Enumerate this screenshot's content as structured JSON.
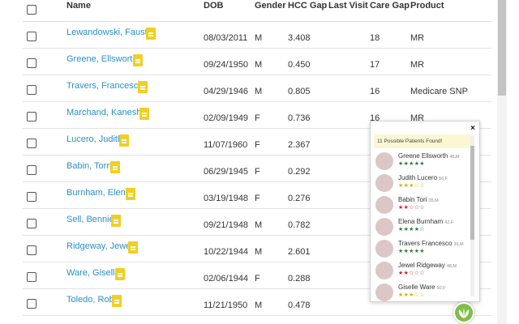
{
  "table": {
    "headers": {
      "name": "Name",
      "dob": "DOB",
      "gender": "Gender",
      "hcc_gap": "HCC Gap",
      "last_visit": "Last Visit",
      "care_gap": "Care Gap",
      "product": "Product"
    },
    "rows": [
      {
        "name": "Lewandowski, Fausto",
        "dob": "08/03/2011",
        "gender": "M",
        "hcc_gap": "3.408",
        "last_visit": "",
        "care_gap": "18",
        "product": "MR"
      },
      {
        "name": "Greene, Ellsworth",
        "dob": "09/24/1950",
        "gender": "M",
        "hcc_gap": "0.450",
        "last_visit": "",
        "care_gap": "17",
        "product": "MR"
      },
      {
        "name": "Travers, Francesco",
        "dob": "04/29/1946",
        "gender": "M",
        "hcc_gap": "0.805",
        "last_visit": "",
        "care_gap": "16",
        "product": "Medicare SNP"
      },
      {
        "name": "Marchand, Kanesha",
        "dob": "02/09/1949",
        "gender": "F",
        "hcc_gap": "0.736",
        "last_visit": "",
        "care_gap": "16",
        "product": "MR"
      },
      {
        "name": "Lucero, Judith",
        "dob": "11/07/1960",
        "gender": "F",
        "hcc_gap": "2.367",
        "last_visit": "",
        "care_gap": "",
        "product": ""
      },
      {
        "name": "Babin, Torri",
        "dob": "06/29/1945",
        "gender": "F",
        "hcc_gap": "0.292",
        "last_visit": "",
        "care_gap": "",
        "product": ""
      },
      {
        "name": "Burnham, Elena",
        "dob": "03/19/1948",
        "gender": "F",
        "hcc_gap": "0.276",
        "last_visit": "",
        "care_gap": "",
        "product": ""
      },
      {
        "name": "Sell, Bennie",
        "dob": "09/21/1948",
        "gender": "M",
        "hcc_gap": "0.782",
        "last_visit": "",
        "care_gap": "",
        "product": ""
      },
      {
        "name": "Ridgeway, Jewel",
        "dob": "10/22/1944",
        "gender": "M",
        "hcc_gap": "2.601",
        "last_visit": "",
        "care_gap": "",
        "product": ""
      },
      {
        "name": "Ware, Giselle",
        "dob": "02/06/1944",
        "gender": "F",
        "hcc_gap": "0.288",
        "last_visit": "",
        "care_gap": "",
        "product": ""
      },
      {
        "name": "Toledo, Rob",
        "dob": "11/21/1950",
        "gender": "M",
        "hcc_gap": "0.478",
        "last_visit": "",
        "care_gap": "",
        "product": ""
      }
    ]
  },
  "popup": {
    "close_label": "×",
    "banner": "11 Possible Patients Found!",
    "patients": [
      {
        "name": "Greene Ellsworth",
        "meta": "45,M",
        "stars": "★★★★★",
        "rating": 5,
        "star_color": "#2e7d32"
      },
      {
        "name": "Judith Lucero",
        "meta": "56,F",
        "stars": "★★★☆☆",
        "rating": 3,
        "star_color": "#d4b106"
      },
      {
        "name": "Babin Tori",
        "meta": "35,M",
        "stars": "★★☆☆☆",
        "rating": 2,
        "star_color": "#c62828"
      },
      {
        "name": "Elena Burnham",
        "meta": "42,F",
        "stars": "★★★★☆",
        "rating": 4,
        "star_color": "#2e7d32"
      },
      {
        "name": "Travers Francesco",
        "meta": "36,M",
        "stars": "★★★★★",
        "rating": 5,
        "star_color": "#2e7d32"
      },
      {
        "name": "Jewel Ridgeway",
        "meta": "48,M",
        "stars": "★★☆☆☆",
        "rating": 2,
        "star_color": "#c62828"
      },
      {
        "name": "Giselle Ware",
        "meta": "50,F",
        "stars": "★★★☆☆",
        "rating": 3,
        "star_color": "#d4b106"
      }
    ]
  },
  "colors": {
    "link": "#2a8fc7",
    "doc_icon": "#f1cf20",
    "banner_bg": "#fcf7d3",
    "fab": "#7fbe49"
  }
}
